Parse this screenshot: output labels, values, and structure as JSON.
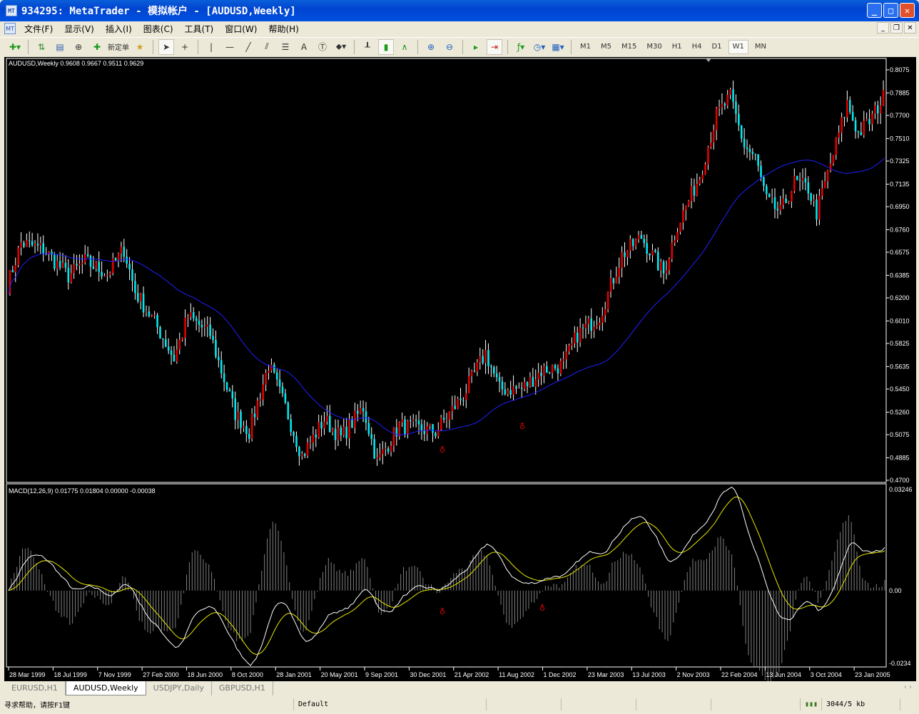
{
  "window": {
    "title": "934295: MetaTrader - 模拟帐户 - [AUDUSD,Weekly]"
  },
  "menu": [
    "文件(F)",
    "显示(V)",
    "插入(I)",
    "图表(C)",
    "工具(T)",
    "窗口(W)",
    "帮助(H)"
  ],
  "toolbar": {
    "new_order": "新定单",
    "text_tool": "A",
    "timeframes": [
      "M1",
      "M5",
      "M15",
      "M30",
      "H1",
      "H4",
      "D1",
      "W1",
      "MN"
    ],
    "active_timeframe": "W1"
  },
  "chart": {
    "header": "AUDUSD,Weekly  0.9608 0.9667 0.9511 0.9629",
    "macd_header": "MACD(12,26,9) 0.01775 0.01804 0.00000 -0.00038"
  },
  "chart_data": {
    "type": "candlestick",
    "symbol": "AUDUSD",
    "period": "Weekly",
    "weeks": 315,
    "anchors": [
      [
        0,
        0.63
      ],
      [
        5,
        0.665
      ],
      [
        13,
        0.66
      ],
      [
        22,
        0.638
      ],
      [
        28,
        0.65
      ],
      [
        36,
        0.64
      ],
      [
        42,
        0.66
      ],
      [
        46,
        0.625
      ],
      [
        53,
        0.6
      ],
      [
        60,
        0.57
      ],
      [
        65,
        0.605
      ],
      [
        73,
        0.59
      ],
      [
        77,
        0.56
      ],
      [
        82,
        0.525
      ],
      [
        87,
        0.51
      ],
      [
        94,
        0.565
      ],
      [
        100,
        0.53
      ],
      [
        106,
        0.49
      ],
      [
        114,
        0.52
      ],
      [
        120,
        0.505
      ],
      [
        128,
        0.53
      ],
      [
        133,
        0.485
      ],
      [
        141,
        0.515
      ],
      [
        154,
        0.51
      ],
      [
        164,
        0.54
      ],
      [
        172,
        0.575
      ],
      [
        177,
        0.545
      ],
      [
        185,
        0.545
      ],
      [
        192,
        0.56
      ],
      [
        200,
        0.565
      ],
      [
        205,
        0.59
      ],
      [
        213,
        0.605
      ],
      [
        221,
        0.655
      ],
      [
        228,
        0.67
      ],
      [
        236,
        0.64
      ],
      [
        241,
        0.68
      ],
      [
        249,
        0.72
      ],
      [
        255,
        0.77
      ],
      [
        260,
        0.785
      ],
      [
        265,
        0.745
      ],
      [
        269,
        0.735
      ],
      [
        273,
        0.7
      ],
      [
        278,
        0.69
      ],
      [
        283,
        0.715
      ],
      [
        288,
        0.71
      ],
      [
        291,
        0.69
      ],
      [
        296,
        0.73
      ],
      [
        302,
        0.78
      ],
      [
        306,
        0.755
      ],
      [
        310,
        0.765
      ],
      [
        315,
        0.785
      ]
    ],
    "ma_period": 40,
    "macd": {
      "fast": 12,
      "slow": 26,
      "signal": 9
    },
    "y_ticks": [
      "0.8075",
      "0.7885",
      "0.7700",
      "0.7510",
      "0.7325",
      "0.7135",
      "0.6950",
      "0.6760",
      "0.6575",
      "0.6385",
      "0.6200",
      "0.6010",
      "0.5825",
      "0.5635",
      "0.5450",
      "0.5260",
      "0.5075",
      "0.4885",
      "0.4700"
    ],
    "y_range": [
      0.47,
      0.8075
    ],
    "macd_ticks": [
      "0.03246",
      "0.00",
      "-0.0234"
    ],
    "macd_range": [
      -0.0234,
      0.03246
    ],
    "x_ticks": [
      "28 Mar 1999",
      "18 Jul 1999",
      "7 Nov 1999",
      "27 Feb 2000",
      "18 Jun 2000",
      "8 Oct 2000",
      "28 Jan 2001",
      "20 May 2001",
      "9 Sep 2001",
      "30 Dec 2001",
      "21 Apr 2002",
      "11 Aug 2002",
      "1 Dec 2002",
      "23 Mar 2003",
      "13 Jul 2003",
      "2 Nov 2003",
      "22 Feb 2004",
      "13 Jun 2004",
      "3 Oct 2004",
      "23 Jan 2005"
    ],
    "colors": {
      "up": "#e00000",
      "down": "#00e8f0",
      "ma": "#2020ff",
      "macd_main": "#ffffff",
      "macd_signal": "#e8e800",
      "hist": "#808080"
    }
  },
  "tabs": [
    "EURUSD,H1",
    "AUDUSD,Weekly",
    "USDJPY,Daily",
    "GBPUSD,H1"
  ],
  "active_tab": "AUDUSD,Weekly",
  "status": {
    "help": "寻求帮助，请按F1键",
    "profile": "Default",
    "traffic": "3044/5 kb"
  }
}
